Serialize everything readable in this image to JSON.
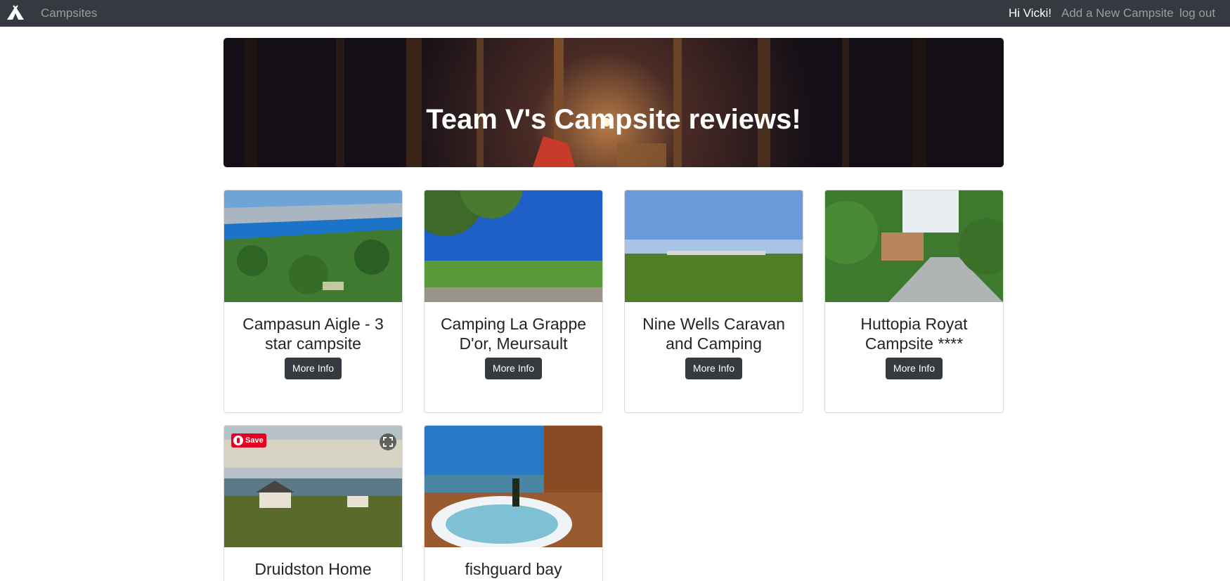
{
  "navbar": {
    "brand_icon": "camp-tent-icon",
    "brand": "Campsites",
    "greeting": "Hi Vicki!",
    "add_link": "Add a New Campsite",
    "logout_link": "log out"
  },
  "jumbotron": {
    "title": "Team V's Campsite reviews!"
  },
  "campgrounds": [
    {
      "title": "Campasun Aigle - 3 star campsite",
      "button": "More Info"
    },
    {
      "title": "Camping La Grappe D'or, Meursault",
      "button": "More Info"
    },
    {
      "title": "Nine Wells Caravan and Camping",
      "button": "More Info"
    },
    {
      "title": "Huttopia Royat Campsite ****",
      "button": "More Info"
    },
    {
      "title": "Druidston Home",
      "pin_save": "Save",
      "expand_icon": "expand-icon"
    },
    {
      "title": "fishguard bay"
    }
  ],
  "colors": {
    "navbar": "#343a40",
    "nav_muted": "#9a9da0",
    "button": "#343a40",
    "pinterest": "#e60023"
  }
}
